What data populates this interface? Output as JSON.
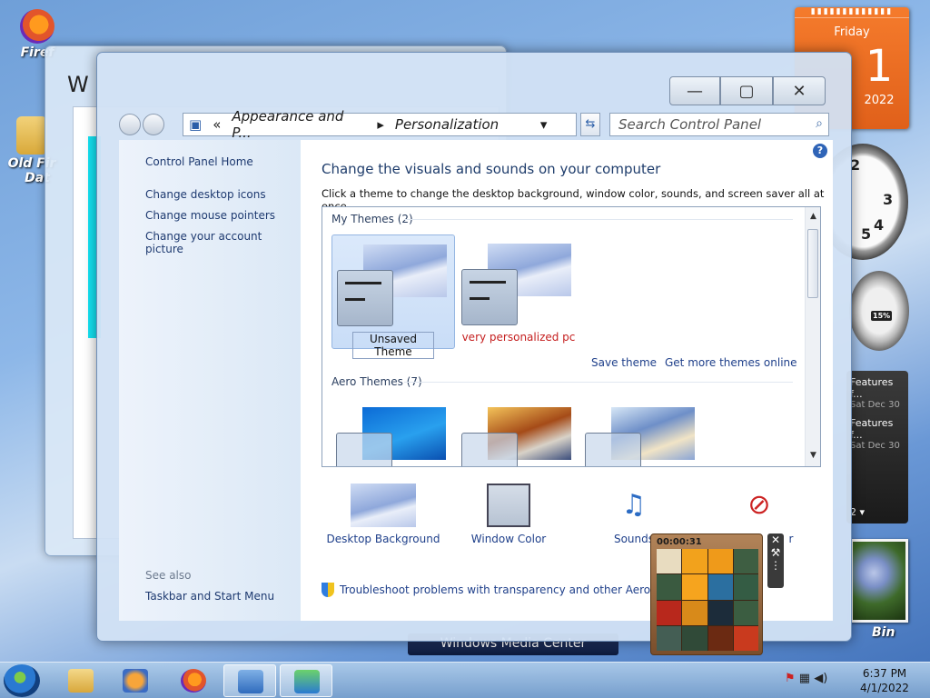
{
  "desktop": {
    "icons": [
      {
        "label": "Firef"
      },
      {
        "label": "Old Fir"
      },
      {
        "label": "Dat"
      }
    ],
    "recycle_bin_label": "Bin",
    "media_center_label": "Windows Media Center"
  },
  "gadgets": {
    "calendar": {
      "day_name": "Friday",
      "day_num": "1",
      "year": "2022"
    },
    "clock_numbers": [
      "2",
      "3",
      "4",
      "5"
    ],
    "cpu_meter": {
      "value": "15%"
    },
    "feed": {
      "items": [
        {
          "title": "Features f...",
          "date": "Sat Dec 30"
        },
        {
          "title": "Features f...",
          "date": "Sat Dec 30"
        }
      ],
      "page": "2"
    },
    "puzzle": {
      "timer": "00:00:31"
    }
  },
  "back_window": {
    "title": "W"
  },
  "window": {
    "caption_buttons": {
      "minimize": "—",
      "maximize": "▢",
      "close": "✕"
    },
    "address": {
      "segment_sep": "«",
      "segment1": "Appearance and P...",
      "segment2": "Personalization",
      "arrow": "▸",
      "dropdown": "▾"
    },
    "refresh_icon": "⇆",
    "search": {
      "placeholder": "Search Control Panel",
      "icon": "⌕"
    },
    "left_pane": {
      "home": "Control Panel Home",
      "links": [
        "Change desktop icons",
        "Change mouse pointers",
        "Change your account picture"
      ],
      "see_also": "See also",
      "taskbar_link": "Taskbar and Start Menu"
    },
    "main": {
      "heading": "Change the visuals and sounds on your computer",
      "description": "Click a theme to change the desktop background, window color, sounds, and screen saver all at once.",
      "help_icon": "?",
      "my_themes_label": "My Themes (2)",
      "my_themes": [
        {
          "name": "Unsaved Theme"
        },
        {
          "name": "very personalized pc"
        }
      ],
      "save_theme": "Save theme",
      "get_more": "Get more themes online",
      "aero_themes_label": "Aero Themes (7)",
      "bottom_items": [
        {
          "label": "Desktop Background",
          "icon": "desktop-background-icon"
        },
        {
          "label": "Window Color",
          "icon": "window-color-icon"
        },
        {
          "label": "Sounds",
          "icon": "sounds-icon"
        },
        {
          "label": "r",
          "icon": "screen-saver-icon"
        }
      ],
      "troubleshoot": "Troubleshoot problems with transparency and other Aero effects"
    }
  },
  "taskbar": {
    "time": "6:37 PM",
    "date": "4/1/2022"
  }
}
